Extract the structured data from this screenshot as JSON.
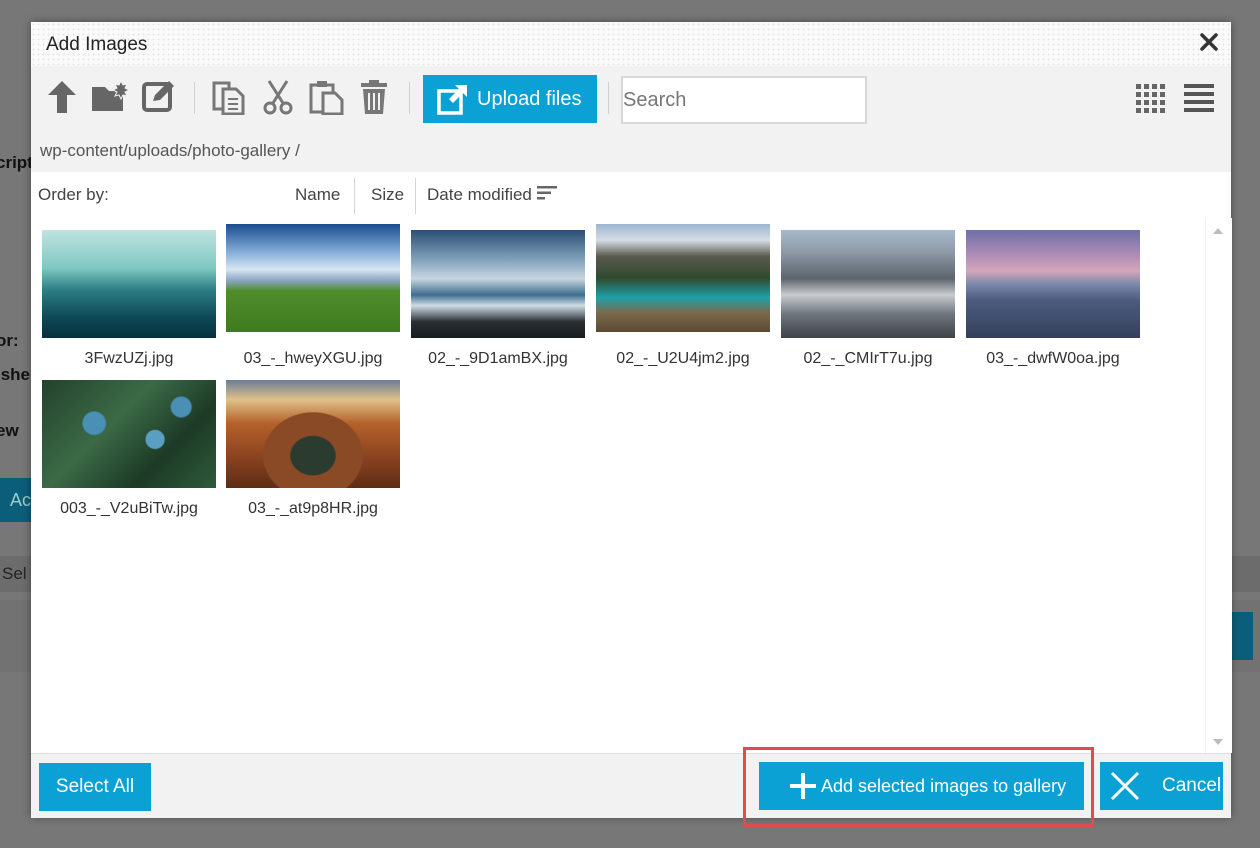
{
  "background": {
    "labels": [
      "cript",
      "or:",
      "ishe",
      "ew",
      "Ac",
      "Sel"
    ]
  },
  "dialog": {
    "title": "Add Images",
    "toolbar": {
      "icons": [
        "arrow-up-icon",
        "new-folder-icon",
        "edit-icon",
        "copy-icon",
        "cut-icon",
        "paste-icon",
        "trash-icon"
      ],
      "upload_label": "Upload files",
      "search_placeholder": "Search"
    },
    "path": "wp-content/uploads/photo-gallery  /",
    "order": {
      "label": "Order by:",
      "options": [
        "Name",
        "Size",
        "Date modified"
      ]
    },
    "images": [
      {
        "name": "3FwzUZj.jpg"
      },
      {
        "name": "03_-_hweyXGU.jpg"
      },
      {
        "name": "02_-_9D1amBX.jpg"
      },
      {
        "name": "02_-_U2U4jm2.jpg"
      },
      {
        "name": "02_-_CMIrT7u.jpg"
      },
      {
        "name": "03_-_dwfW0oa.jpg"
      },
      {
        "name": "003_-_V2uBiTw.jpg"
      },
      {
        "name": "03_-_at9p8HR.jpg"
      }
    ],
    "footer": {
      "select_all": "Select All",
      "add_selected": "Add selected images to gallery",
      "cancel": "Cancel"
    }
  },
  "colors": {
    "accent": "#0ba1d5",
    "highlight": "#e24b4b"
  }
}
